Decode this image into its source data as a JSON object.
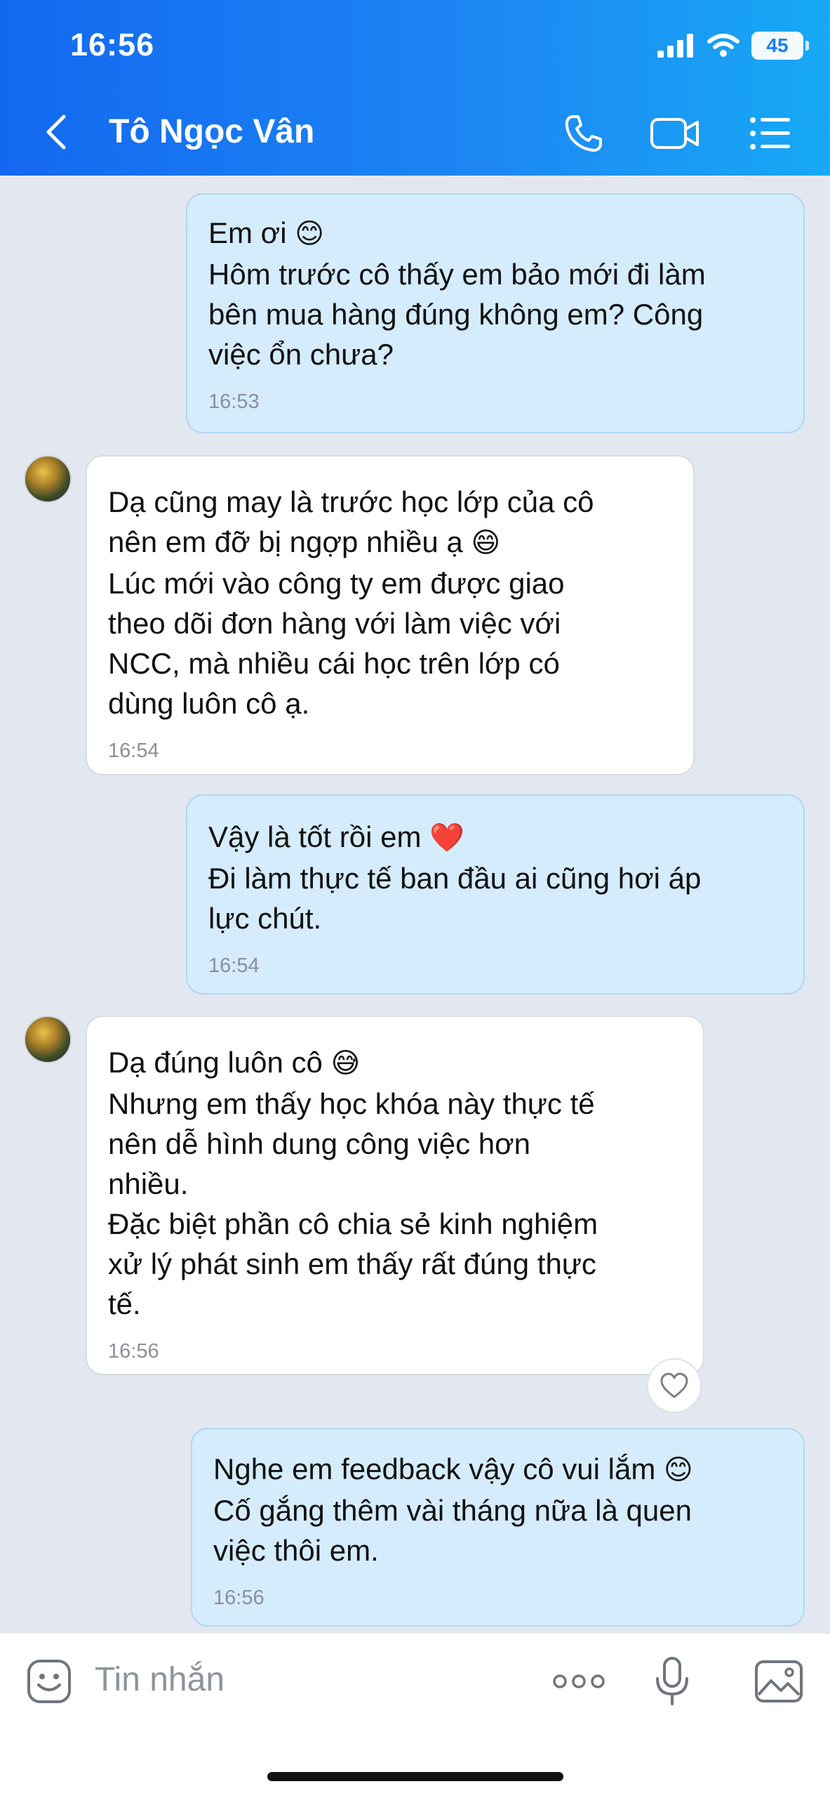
{
  "status_bar": {
    "time": "16:56",
    "battery": "45"
  },
  "header": {
    "contact_name": "Tô Ngọc Vân"
  },
  "messages": [
    {
      "text": "Em ơi",
      "emoji": "😊",
      "body": "Hôm trước cô thấy em bảo mới đi làm\nbên mua hàng đúng không em? Công\nviệc ổn chưa?",
      "time": "16:53"
    },
    {
      "text": "Dạ cũng may là trước học lớp của cô\nnên em đỡ bị ngợp nhiều ạ",
      "emoji": "😄",
      "body": "Lúc mới vào công ty em được giao\ntheo dõi đơn hàng với làm việc với\nNCC, mà nhiều cái học trên lớp có\ndùng luôn cô ạ.",
      "time": "16:54"
    },
    {
      "text": "Vậy là tốt rồi em",
      "emoji": "❤️",
      "body": "Đi làm thực tế ban đầu ai cũng hơi áp\nlực chút.",
      "time": "16:54"
    },
    {
      "text": "Dạ đúng luôn cô",
      "emoji": "😅",
      "body": "Nhưng em thấy học khóa này thực tế\nnên dễ hình dung công việc hơn\nnhiều.\nĐặc biệt phần cô chia sẻ kinh nghiệm\nxử lý phát sinh em thấy rất đúng thực\ntế.",
      "time": "16:56"
    },
    {
      "text": "Nghe em feedback vậy cô vui lắm",
      "emoji": "😊",
      "body": "Cố gắng thêm vài tháng nữa là quen\nviệc thôi em.",
      "time": "16:56"
    }
  ],
  "input": {
    "placeholder": "Tin nhắn"
  },
  "icons": {
    "back": "chevron-left-icon",
    "call": "phone-icon",
    "video": "video-camera-icon",
    "menu": "list-menu-icon",
    "sticker": "sticker-smile-icon",
    "more": "more-dots-icon",
    "mic": "mic-icon",
    "gallery": "image-icon",
    "react": "heart-icon"
  },
  "colors": {
    "header_start": "#1368f0",
    "header_end": "#17a9f5",
    "outgoing_bubble": "#d4ecfc",
    "incoming_bubble": "#ffffff",
    "chat_bg": "#e3e7ef"
  }
}
